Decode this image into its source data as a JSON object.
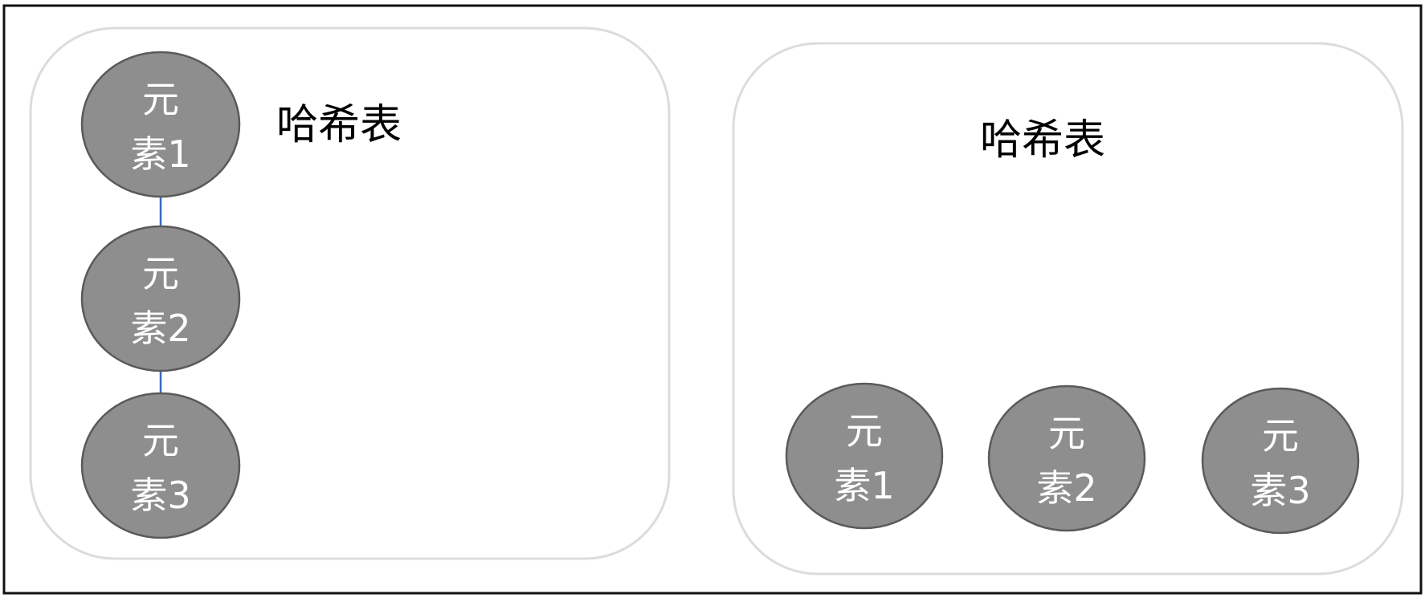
{
  "colors": {
    "frame_border": "#111111",
    "panel_border": "#dcdcdc",
    "node_fill": "#8e8e8e",
    "node_stroke": "#5a5a5a",
    "node_text": "#ffffff",
    "connector": "#3a67c4",
    "title_text": "#000000"
  },
  "left_panel": {
    "title": "哈希表",
    "nodes": [
      {
        "line1": "元",
        "line2": "素1"
      },
      {
        "line1": "元",
        "line2": "素2"
      },
      {
        "line1": "元",
        "line2": "素3"
      }
    ]
  },
  "right_panel": {
    "title": "哈希表",
    "nodes": [
      {
        "line1": "元",
        "line2": "素1"
      },
      {
        "line1": "元",
        "line2": "素2"
      },
      {
        "line1": "元",
        "line2": "素3"
      }
    ]
  }
}
